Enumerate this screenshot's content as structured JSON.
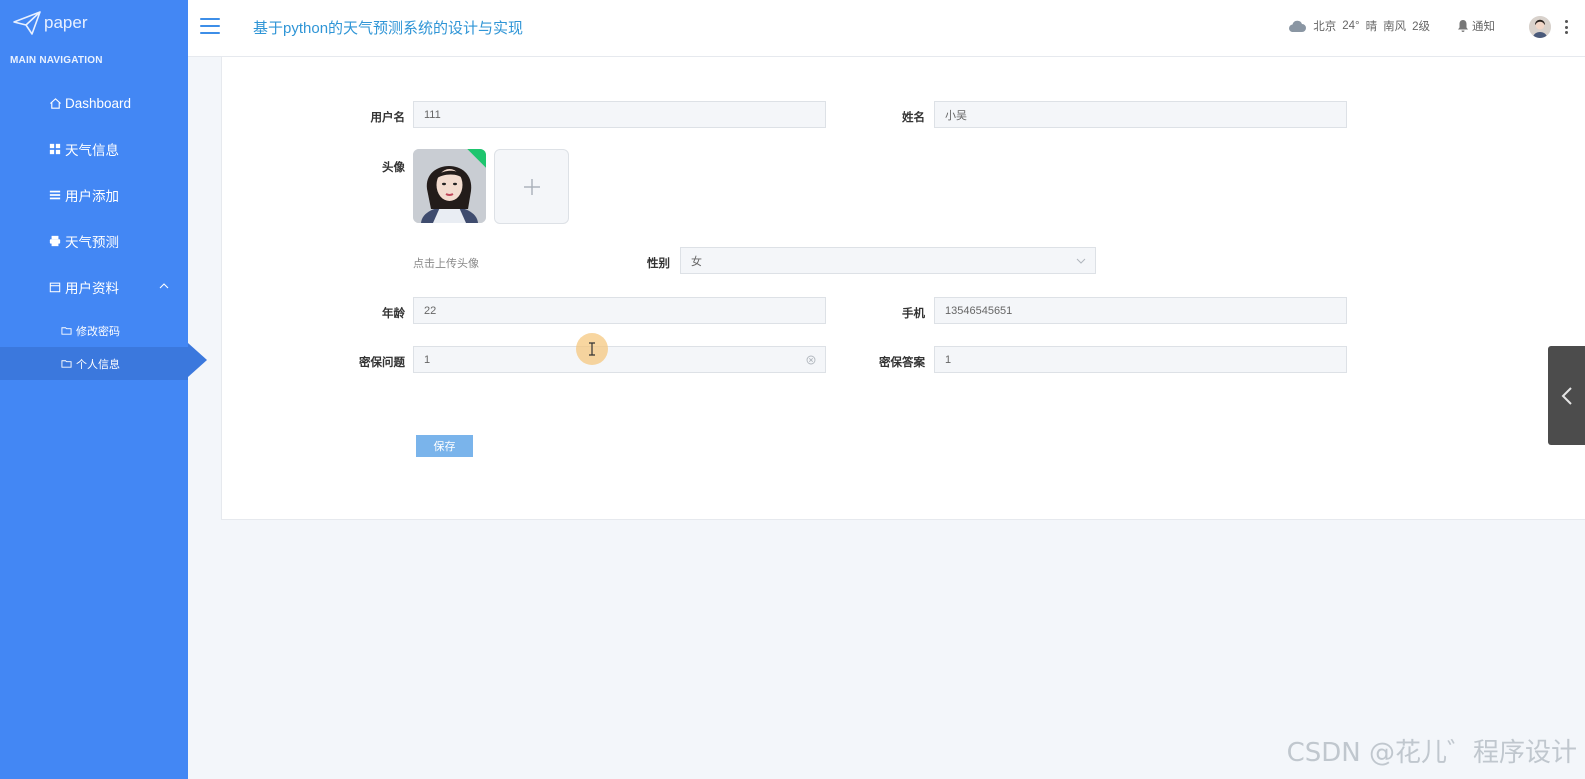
{
  "brand": {
    "logo_text": "paper"
  },
  "sidebar": {
    "section_title": "MAIN NAVIGATION",
    "items": [
      {
        "label": "Dashboard",
        "icon": "home-icon"
      },
      {
        "label": "天气信息",
        "icon": "grid-icon"
      },
      {
        "label": "用户添加",
        "icon": "list-icon"
      },
      {
        "label": "天气预测",
        "icon": "printer-icon"
      },
      {
        "label": "用户资料",
        "icon": "calendar-icon",
        "expanded": true
      }
    ],
    "sub_items": [
      {
        "label": "修改密码",
        "icon": "folder-icon"
      },
      {
        "label": "个人信息",
        "icon": "folder-icon",
        "active": true
      }
    ]
  },
  "header": {
    "title": "基于python的天气预测系统的设计与实现",
    "weather": {
      "city": "北京",
      "temp": "24°",
      "condition": "晴",
      "wind": "南风",
      "level": "2级"
    },
    "notify_label": "通知"
  },
  "form": {
    "username": {
      "label": "用户名",
      "value": "111"
    },
    "name": {
      "label": "姓名",
      "value": "小吴"
    },
    "avatar": {
      "label": "头像",
      "upload_hint": "点击上传头像"
    },
    "gender": {
      "label": "性别",
      "value": "女"
    },
    "age": {
      "label": "年龄",
      "value": "22"
    },
    "phone": {
      "label": "手机",
      "value": "13546545651"
    },
    "security_question": {
      "label": "密保问题",
      "value": "1"
    },
    "security_answer": {
      "label": "密保答案",
      "value": "1"
    },
    "save_label": "保存"
  },
  "watermark": "CSDN @花儿゛程序设计",
  "colors": {
    "sidebar": "#4387f4",
    "accent": "#2f95d6",
    "save_button": "#7ab4eb",
    "page_bg": "#f3f6fa"
  }
}
